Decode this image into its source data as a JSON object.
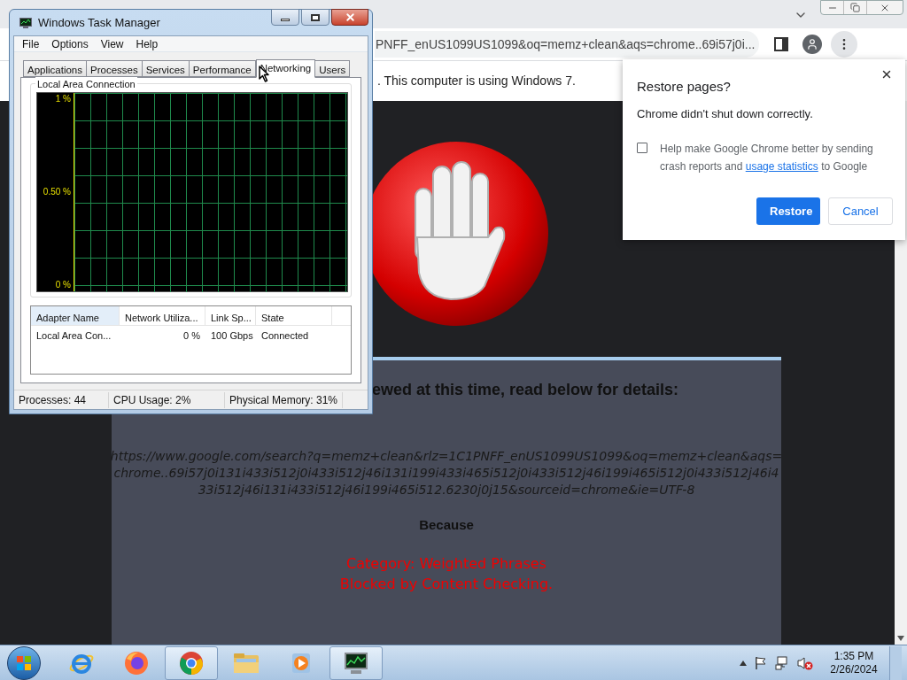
{
  "browser": {
    "address_bar": {
      "value": "PNFF_enUS1099US1099&oq=memz+clean&aqs=chrome..69i57j0i..."
    },
    "info_bar": {
      "text": ". This computer is using Windows 7."
    }
  },
  "block_page": {
    "heading": "ewed at this time, read below for details:",
    "url_lines": [
      "https://www.google.com/search?q=memz+clean&rlz=1C1PNFF_enUS1099US1099&oq=memz+clean&aqs=",
      "chrome..69i57j0i131i433i512j0i433i512j46i131i199i433i465i512j0i433i512j46i199i465i512j0i433i512j46i4",
      "33i512j46i131i433i512j46i199i465i512.6230j0j15&sourceid=chrome&ie=UTF-8"
    ],
    "because": "Because",
    "reasons": [
      "Category: Weighted Phrases",
      "Blocked by Content Checking."
    ]
  },
  "restore_dialog": {
    "title": "Restore pages?",
    "message": "Chrome didn't shut down correctly.",
    "checkbox": {
      "label_before": "Help make Google Chrome better by sending crash reports and",
      "link": "usage statistics",
      "label_after": "to Google",
      "checked": false
    },
    "buttons": [
      {
        "label": "Restore",
        "kind": "primary"
      },
      {
        "label": "Cancel",
        "kind": "secondary"
      }
    ]
  },
  "task_manager": {
    "title": "Windows Task Manager",
    "menu": [
      "File",
      "Options",
      "View",
      "Help"
    ],
    "tabs": [
      {
        "label": "Applications",
        "selected": false
      },
      {
        "label": "Processes",
        "selected": false
      },
      {
        "label": "Services",
        "selected": false
      },
      {
        "label": "Performance",
        "selected": false
      },
      {
        "label": "Networking",
        "selected": true
      },
      {
        "label": "Users",
        "selected": false
      }
    ],
    "graph": {
      "title": "Local Area Connection",
      "y_labels": [
        "1 %",
        "0.50 %",
        "0 %"
      ]
    },
    "table": {
      "columns": [
        "Adapter Name",
        "Network Utiliza...",
        "Link Sp...",
        "State"
      ],
      "rows": [
        [
          "Local Area Con...",
          "0 %",
          "100 Gbps",
          "Connected"
        ]
      ]
    },
    "status_bar": [
      "Processes: 44",
      "CPU Usage: 2%",
      "Physical Memory: 31%"
    ]
  },
  "taskbar": {
    "apps": [
      {
        "kind": "ie",
        "open": false
      },
      {
        "kind": "firefox",
        "open": false
      },
      {
        "kind": "chrome",
        "open": true
      },
      {
        "kind": "explorer",
        "open": false
      },
      {
        "kind": "media",
        "open": false
      },
      {
        "kind": "taskmgr",
        "open": true
      }
    ],
    "clock": {
      "time": "1:35 PM",
      "date": "2/26/2024"
    }
  }
}
